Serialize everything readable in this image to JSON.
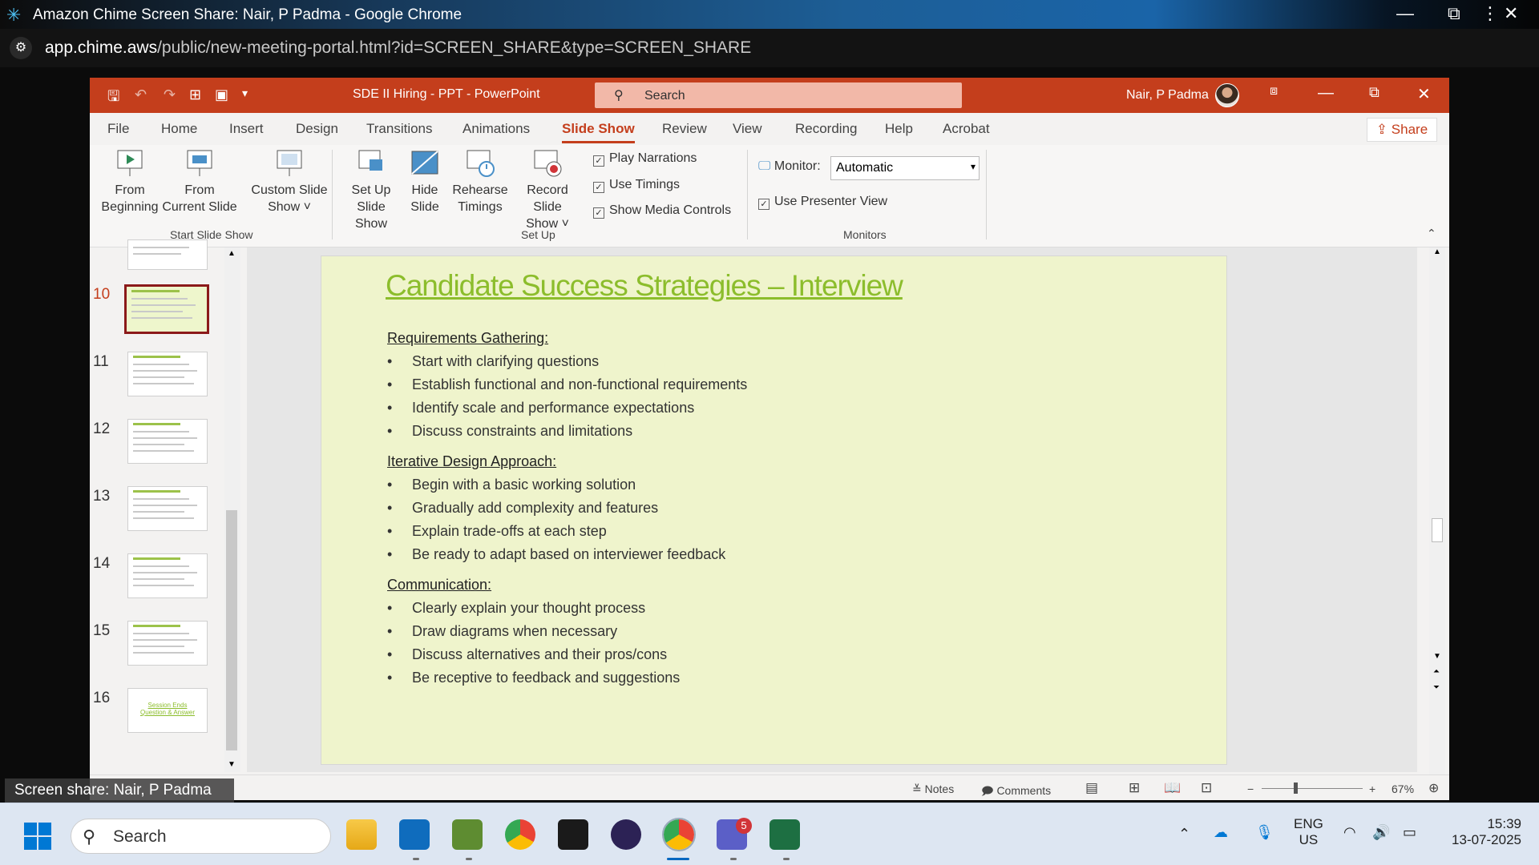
{
  "browser": {
    "window_title": "Amazon Chime Screen Share: Nair, P Padma - Google Chrome",
    "url_domain": "app.chime.aws",
    "url_path": "/public/new-meeting-portal.html?id=SCREEN_SHARE&type=SCREEN_SHARE"
  },
  "ppt": {
    "doc_title": "SDE II Hiring - PPT  -  PowerPoint",
    "search_placeholder": "Search",
    "user_name": "Nair, P Padma",
    "tabs": [
      "File",
      "Home",
      "Insert",
      "Design",
      "Transitions",
      "Animations",
      "Slide Show",
      "Review",
      "View",
      "Recording",
      "Help",
      "Acrobat"
    ],
    "active_tab": "Slide Show",
    "share_label": "Share",
    "ribbon": {
      "from_beginning": [
        "From",
        "Beginning"
      ],
      "from_current": [
        "From",
        "Current Slide"
      ],
      "custom_show": [
        "Custom Slide",
        "Show ˅"
      ],
      "group_start": "Start Slide Show",
      "set_up_show": [
        "Set Up",
        "Slide Show"
      ],
      "hide_slide": [
        "Hide",
        "Slide"
      ],
      "rehearse": [
        "Rehearse",
        "Timings"
      ],
      "record": [
        "Record Slide",
        "Show ˅"
      ],
      "play_narrations": "Play Narrations",
      "use_timings": "Use Timings",
      "show_media_controls": "Show Media Controls",
      "group_setup": "Set Up",
      "monitor_label": "Monitor:",
      "monitor_value": "Automatic",
      "use_presenter_view": "Use Presenter View",
      "group_monitors": "Monitors"
    },
    "thumbnails": [
      {
        "num": "10",
        "selected": true
      },
      {
        "num": "11",
        "selected": false
      },
      {
        "num": "12",
        "selected": false
      },
      {
        "num": "13",
        "selected": false
      },
      {
        "num": "14",
        "selected": false
      },
      {
        "num": "15",
        "selected": false
      },
      {
        "num": "16",
        "selected": false,
        "text": "Session Ends\nQuestion & Answer"
      }
    ],
    "slide": {
      "title": "Candidate Success Strategies – Interview",
      "sections": [
        {
          "heading": "Requirements Gathering:",
          "bullets": [
            "Start with clarifying questions",
            "Establish functional and non-functional requirements",
            "Identify scale and performance expectations",
            "Discuss constraints and limitations"
          ]
        },
        {
          "heading": "Iterative Design Approach:",
          "bullets": [
            "Begin with a basic working solution",
            "Gradually add complexity and features",
            "Explain trade-offs at each step",
            "Be ready to adapt based on interviewer feedback"
          ]
        },
        {
          "heading": "Communication:",
          "bullets": [
            "Clearly explain your thought process",
            "Draw diagrams when necessary",
            "Discuss alternatives and their pros/cons",
            "Be receptive to feedback and suggestions"
          ]
        }
      ]
    },
    "status": {
      "notes": "Notes",
      "comments": "Comments",
      "zoom": "67%"
    }
  },
  "overlay": {
    "screen_share_label": "Screen share: Nair, P Padma"
  },
  "taskbar": {
    "search_label": "Search",
    "teams_badge": "5",
    "lang_top": "ENG",
    "lang_bottom": "US",
    "time": "15:39",
    "date": "13-07-2025"
  }
}
